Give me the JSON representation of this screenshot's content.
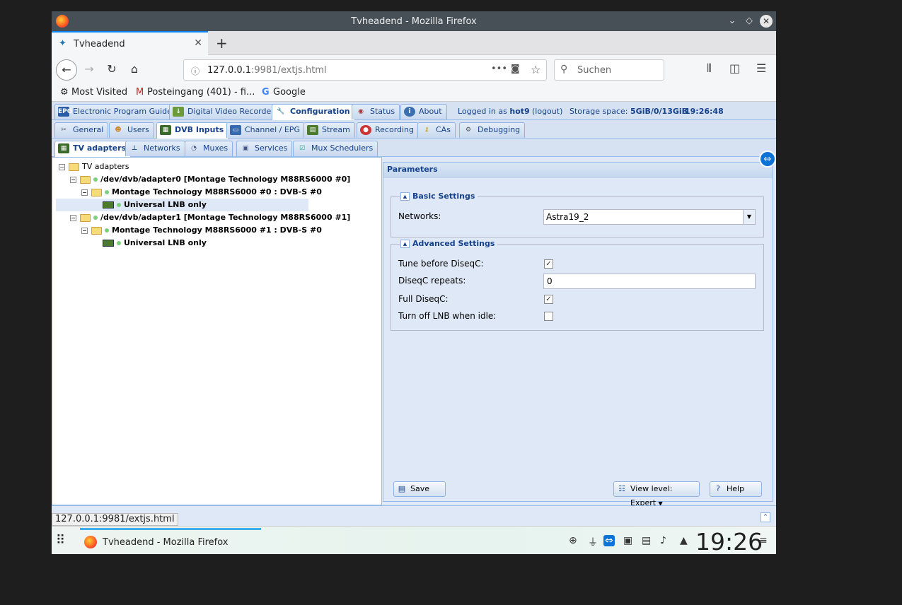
{
  "window": {
    "title": "Tvheadend - Mozilla Firefox"
  },
  "browser": {
    "tab_title": "Tvheadend",
    "url_host": "127.0.0.1",
    "url_rest": ":9981/extjs.html",
    "search_placeholder": "Suchen",
    "bookmarks": [
      "Most Visited",
      "Posteingang (401) - fi...",
      "Google"
    ]
  },
  "top_tabs": [
    "Electronic Program Guide",
    "Digital Video Recorder",
    "Configuration",
    "Status",
    "About"
  ],
  "login": {
    "prefix": "Logged in as",
    "user": "hot9",
    "logout": "(logout)",
    "storage_label": "Storage space:",
    "storage_value": "5GiB/0/13GiB",
    "time": "19:26:48"
  },
  "config_tabs": [
    "General",
    "Users",
    "DVB Inputs",
    "Channel / EPG",
    "Stream",
    "Recording",
    "CAs",
    "Debugging"
  ],
  "dvb_tabs": [
    "TV adapters",
    "Networks",
    "Muxes",
    "Services",
    "Mux Schedulers"
  ],
  "tree": [
    "TV adapters",
    "/dev/dvb/adapter0 [Montage Technology M88RS6000 #0]",
    "Montage Technology M88RS6000 #0 : DVB-S #0",
    "Universal LNB only",
    "/dev/dvb/adapter1 [Montage Technology M88RS6000 #1]",
    "Montage Technology M88RS6000 #1 : DVB-S #0",
    "Universal LNB only"
  ],
  "params": {
    "title": "Parameters",
    "basic_legend": "Basic Settings",
    "networks_label": "Networks:",
    "networks_value": "Astra19_2",
    "advanced_legend": "Advanced Settings",
    "tune_label": "Tune before DiseqC:",
    "repeats_label": "DiseqC repeats:",
    "repeats_value": "0",
    "full_label": "Full DiseqC:",
    "lnb_off_label": "Turn off LNB when idle:",
    "tune_checked": true,
    "full_checked": true,
    "lnb_off_checked": false,
    "save": "Save",
    "view_level": "View level: Expert",
    "help": "Help"
  },
  "statusbar": {
    "url": "127.0.0.1:9981/extjs.html"
  },
  "taskbar": {
    "task": "Tvheadend - Mozilla Firefox",
    "clock": "19:26"
  }
}
